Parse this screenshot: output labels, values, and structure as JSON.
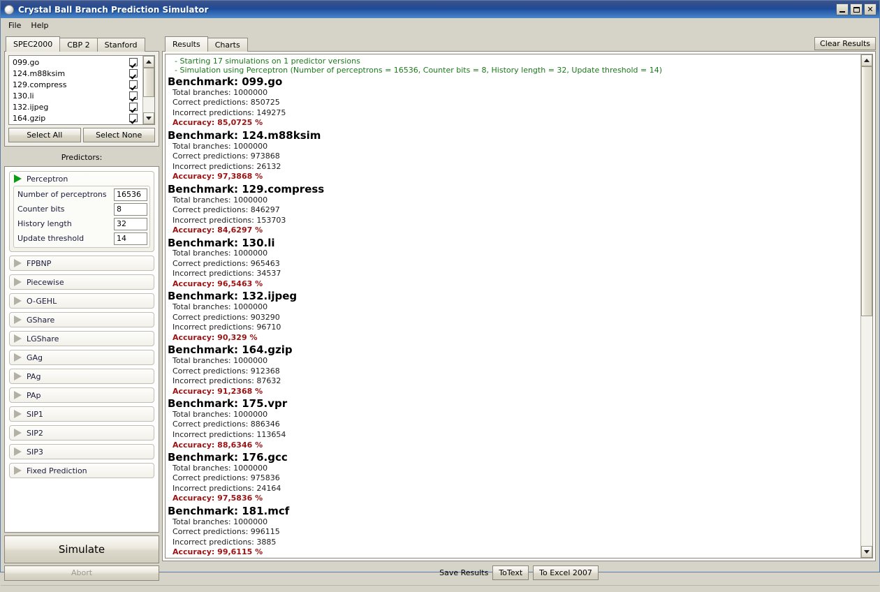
{
  "window": {
    "title": "Crystal Ball Branch Prediction Simulator",
    "icon": "crystal-ball-icon",
    "minimize_label": "_",
    "maximize_label": "□",
    "close_label": "✕"
  },
  "menu": {
    "items": [
      {
        "label": "File"
      },
      {
        "label": "Help"
      }
    ]
  },
  "left_panel": {
    "benchmark_tabs": [
      {
        "label": "SPEC2000",
        "active": true
      },
      {
        "label": "CBP 2",
        "active": false
      },
      {
        "label": "Stanford",
        "active": false
      }
    ],
    "benchmarks": [
      {
        "name": "099.go",
        "checked": true
      },
      {
        "name": "124.m88ksim",
        "checked": true
      },
      {
        "name": "129.compress",
        "checked": true
      },
      {
        "name": "130.li",
        "checked": true
      },
      {
        "name": "132.ijpeg",
        "checked": true
      },
      {
        "name": "164.gzip",
        "checked": true
      }
    ],
    "select_all_label": "Select All",
    "select_none_label": "Select None",
    "predictors_label": "Predictors:",
    "predictors": [
      {
        "name": "Perceptron",
        "expanded": true,
        "params": [
          {
            "label": "Number of perceptrons",
            "value": "16536"
          },
          {
            "label": "Counter bits",
            "value": "8"
          },
          {
            "label": "History length",
            "value": "32"
          },
          {
            "label": "Update threshold",
            "value": "14"
          }
        ]
      },
      {
        "name": "FPBNP",
        "expanded": false,
        "params": []
      },
      {
        "name": "Piecewise",
        "expanded": false,
        "params": []
      },
      {
        "name": "O-GEHL",
        "expanded": false,
        "params": []
      },
      {
        "name": "GShare",
        "expanded": false,
        "params": []
      },
      {
        "name": "LGShare",
        "expanded": false,
        "params": []
      },
      {
        "name": "GAg",
        "expanded": false,
        "params": []
      },
      {
        "name": "PAg",
        "expanded": false,
        "params": []
      },
      {
        "name": "PAp",
        "expanded": false,
        "params": []
      },
      {
        "name": "SIP1",
        "expanded": false,
        "params": []
      },
      {
        "name": "SIP2",
        "expanded": false,
        "params": []
      },
      {
        "name": "SIP3",
        "expanded": false,
        "params": []
      },
      {
        "name": "Fixed Prediction",
        "expanded": false,
        "params": []
      }
    ],
    "simulate_label": "Simulate",
    "abort_label": "Abort"
  },
  "right_panel": {
    "tabs": [
      {
        "label": "Results",
        "active": true
      },
      {
        "label": "Charts",
        "active": false
      }
    ],
    "clear_results_label": "Clear Results",
    "log_lines": [
      "-  Starting 17 simulations on 1 predictor versions",
      "-  Simulation using Perceptron (Number of perceptrons = 16536, Counter bits = 8, History length = 32, Update threshold = 14)"
    ],
    "stat_labels": {
      "total": "Total branches:",
      "correct": "Correct predictions:",
      "incorrect": "Incorrect predictions:",
      "accuracy": "Accuracy:",
      "benchmark_prefix": "Benchmark:",
      "percent": "%"
    },
    "results": [
      {
        "benchmark": "099.go",
        "total_branches": "1000000",
        "correct": "850725",
        "incorrect": "149275",
        "accuracy": "85,0725"
      },
      {
        "benchmark": "124.m88ksim",
        "total_branches": "1000000",
        "correct": "973868",
        "incorrect": "26132",
        "accuracy": "97,3868"
      },
      {
        "benchmark": "129.compress",
        "total_branches": "1000000",
        "correct": "846297",
        "incorrect": "153703",
        "accuracy": "84,6297"
      },
      {
        "benchmark": "130.li",
        "total_branches": "1000000",
        "correct": "965463",
        "incorrect": "34537",
        "accuracy": "96,5463"
      },
      {
        "benchmark": "132.ijpeg",
        "total_branches": "1000000",
        "correct": "903290",
        "incorrect": "96710",
        "accuracy": "90,329"
      },
      {
        "benchmark": "164.gzip",
        "total_branches": "1000000",
        "correct": "912368",
        "incorrect": "87632",
        "accuracy": "91,2368"
      },
      {
        "benchmark": "175.vpr",
        "total_branches": "1000000",
        "correct": "886346",
        "incorrect": "113654",
        "accuracy": "88,6346"
      },
      {
        "benchmark": "176.gcc",
        "total_branches": "1000000",
        "correct": "975836",
        "incorrect": "24164",
        "accuracy": "97,5836"
      },
      {
        "benchmark": "181.mcf",
        "total_branches": "1000000",
        "correct": "996115",
        "incorrect": "3885",
        "accuracy": "99,6115"
      }
    ],
    "save_results_label": "Save Results",
    "to_text_label": "ToText",
    "to_excel_label": "To Excel 2007"
  },
  "colors": {
    "titlebar": "#1c4a96",
    "log_green": "#1b7a1b",
    "accuracy_red": "#9d1212",
    "expanded_triangle_green": "#0b9b16",
    "collapsed_triangle_gray": "#b3b0a6",
    "panel_face": "#d6d3c8"
  }
}
